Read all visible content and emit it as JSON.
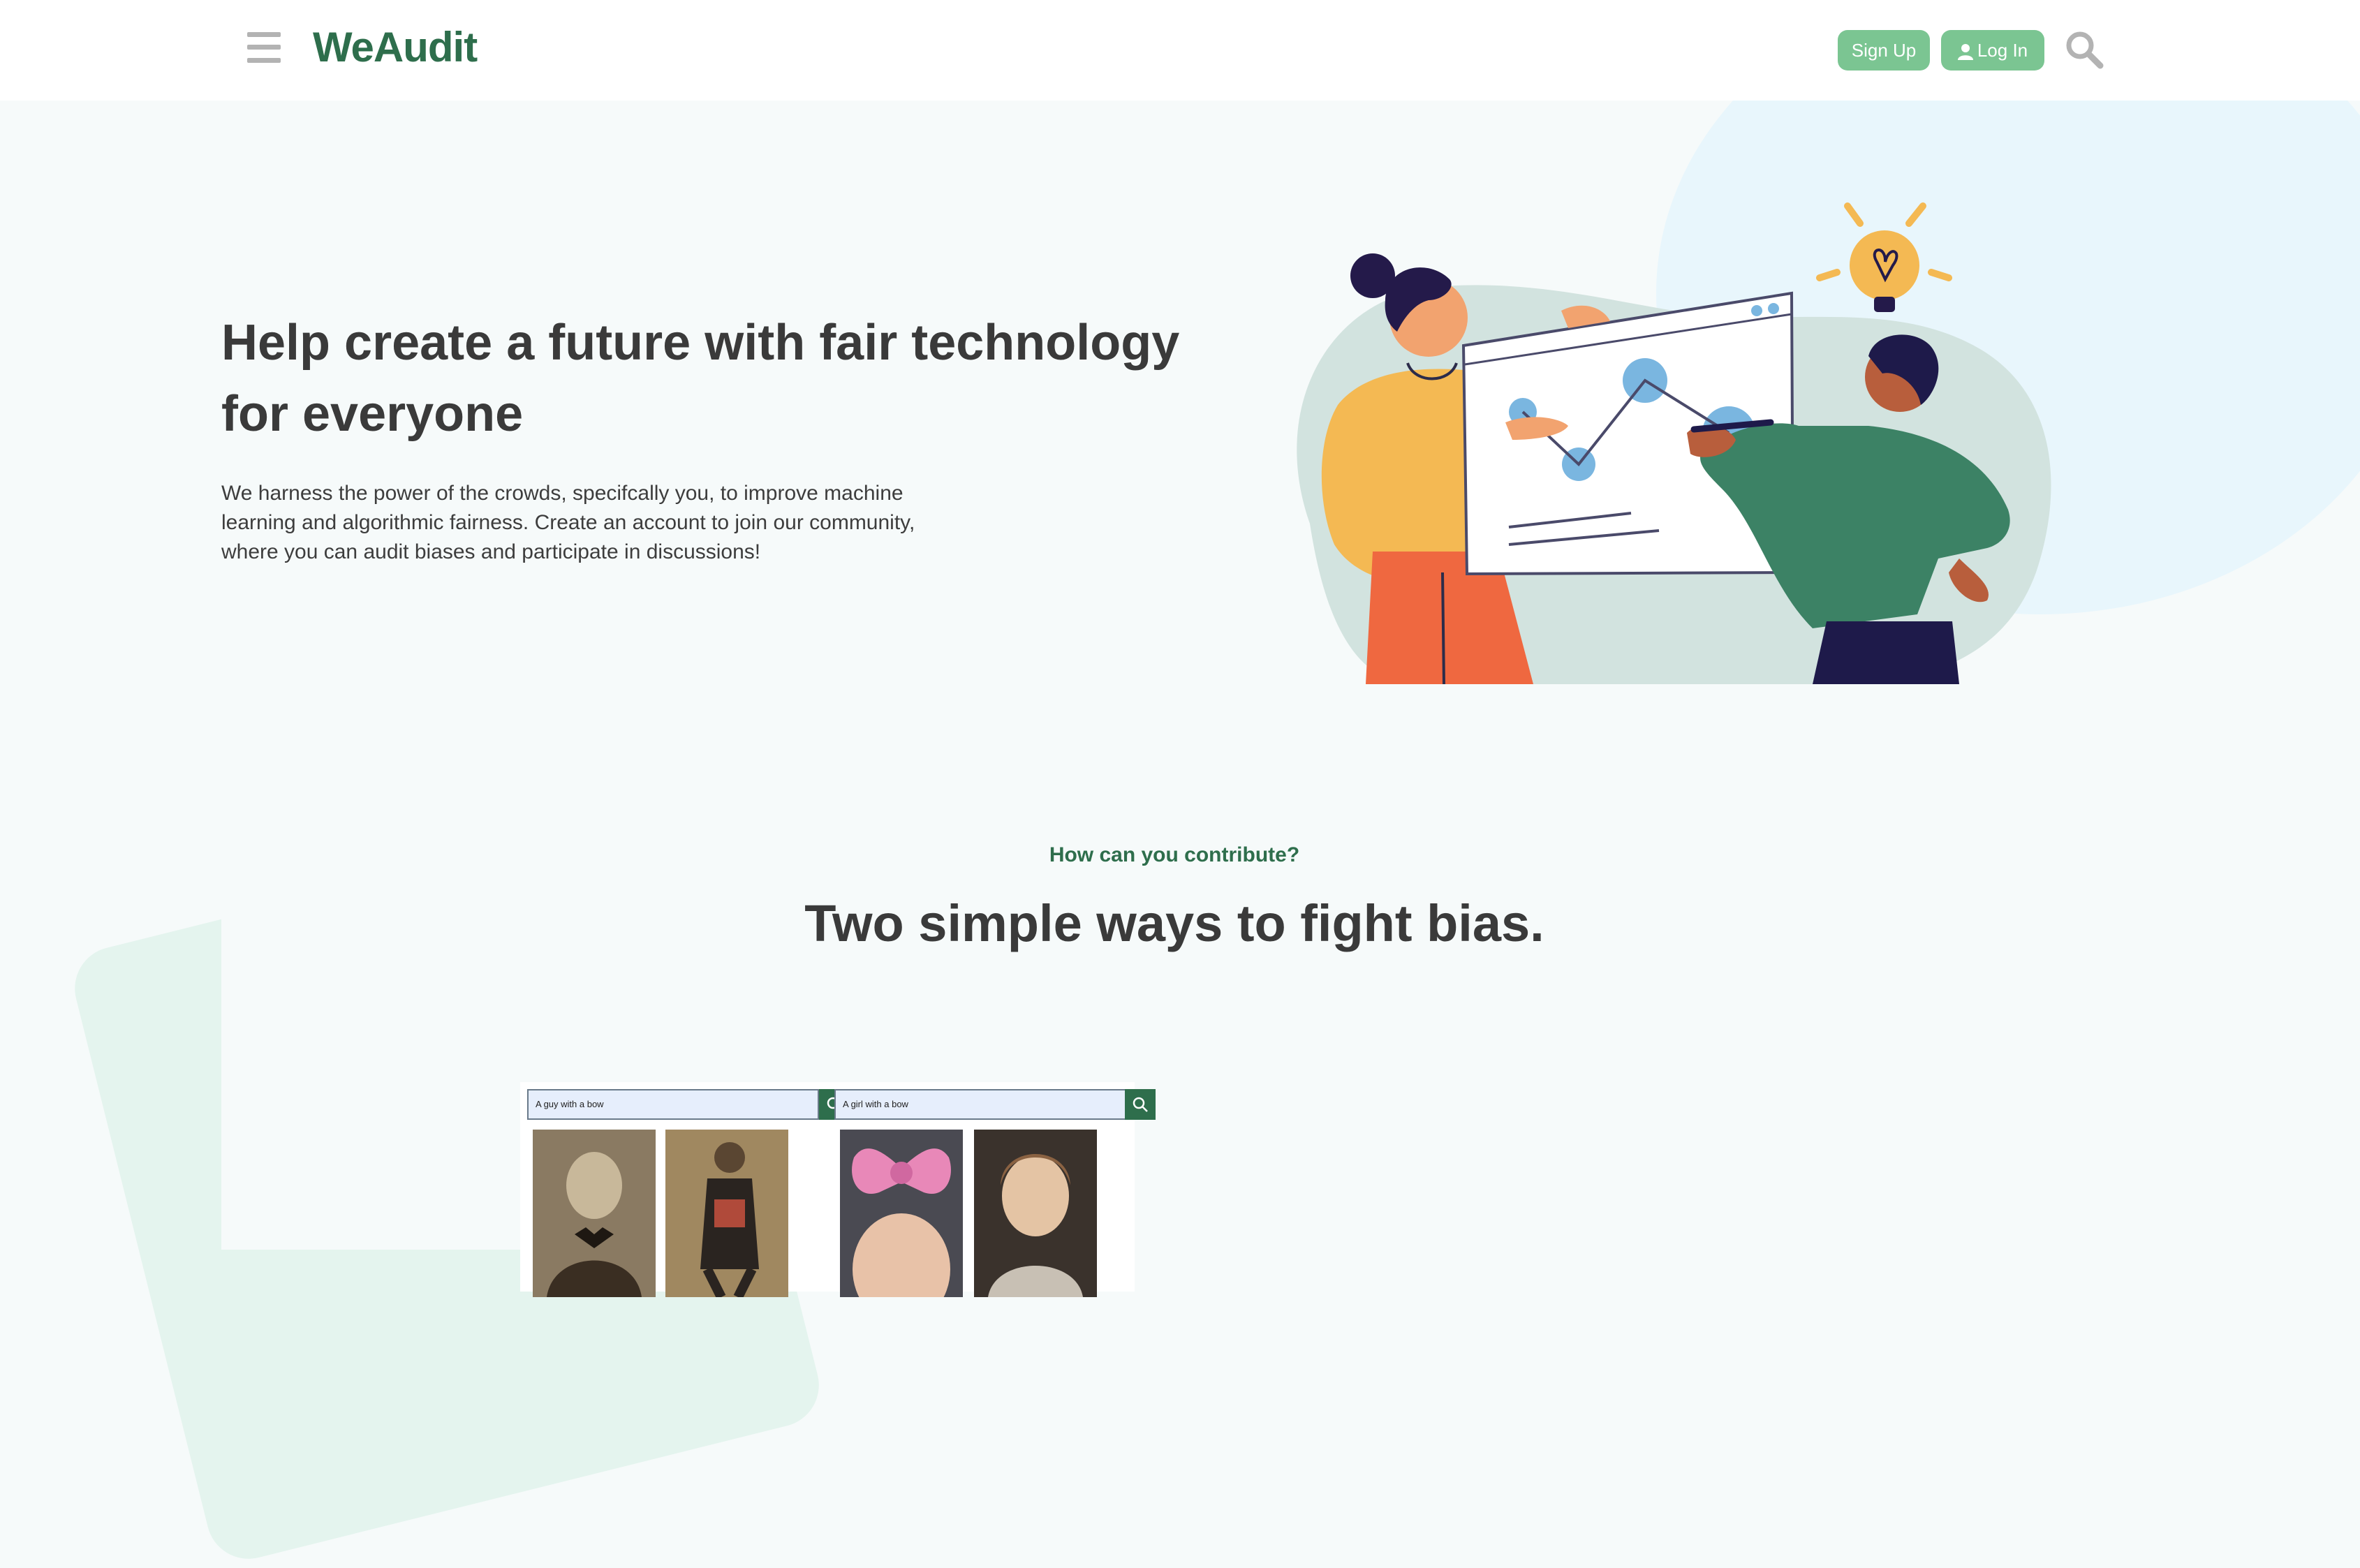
{
  "header": {
    "logo": "WeAudit",
    "signup_label": "Sign Up",
    "login_label": "Log In",
    "icons": [
      "hamburger-icon",
      "user-icon",
      "search-icon"
    ]
  },
  "hero": {
    "title": "Help create a future with fair technology for everyone",
    "description": "We harness the power of the crowds, specifcally you, to improve machine learning and algorithmic fairness. Create an account to join our community, where you can audit biases and participate in discussions!"
  },
  "contribute": {
    "kicker": "How can you contribute?",
    "title": "Two simple ways to fight bias."
  },
  "demo": {
    "search_left": "A guy with a bow",
    "search_right": "A girl with a bow"
  },
  "colors": {
    "brand": "#2e6e4c",
    "button": "#7bc592",
    "background": "#f6fafa"
  }
}
